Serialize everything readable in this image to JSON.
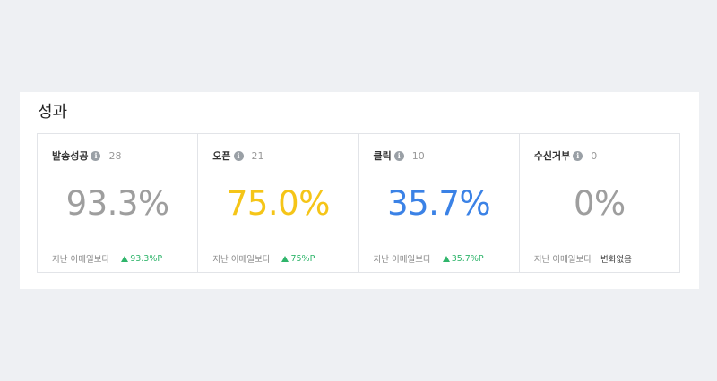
{
  "section": {
    "title": "성과"
  },
  "cards": [
    {
      "label": "발송성공",
      "count": "28",
      "value": "93.3%",
      "value_color": "#9e9e9e",
      "foot_label": "지난 이메일보다",
      "change": "93.3%P",
      "trend": "up"
    },
    {
      "label": "오픈",
      "count": "21",
      "value": "75.0%",
      "value_color": "#f5c518",
      "foot_label": "지난 이메일보다",
      "change": "75%P",
      "trend": "up"
    },
    {
      "label": "클릭",
      "count": "10",
      "value": "35.7%",
      "value_color": "#3b82e6",
      "foot_label": "지난 이메일보다",
      "change": "35.7%P",
      "trend": "up"
    },
    {
      "label": "수신거부",
      "count": "0",
      "value": "0%",
      "value_color": "#9e9e9e",
      "foot_label": "지난 이메일보다",
      "change": "변화없음",
      "trend": "none"
    }
  ],
  "icons": {
    "info": "info-icon",
    "trend_up": "triangle-up-icon"
  },
  "colors": {
    "positive": "#2fb56b"
  }
}
